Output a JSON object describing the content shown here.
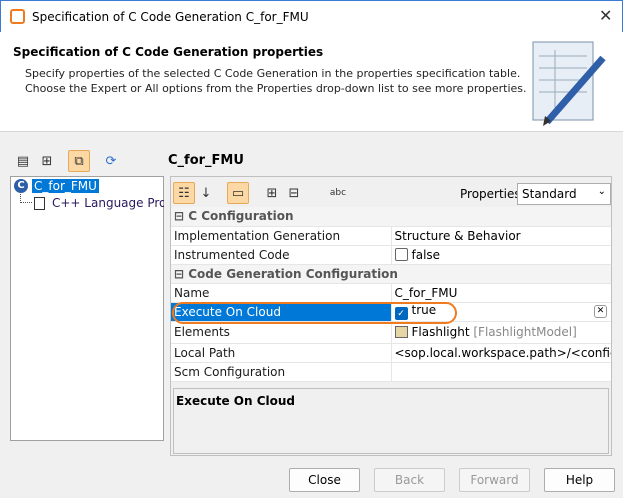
{
  "window": {
    "title": "Specification of C Code Generation C_for_FMU"
  },
  "header": {
    "title": "Specification of C Code Generation properties",
    "desc1": "Specify properties of the selected C Code Generation in the properties specification table.",
    "desc2": "Choose the Expert or All options from the Properties drop-down list to see more properties."
  },
  "element_title": "C_for_FMU",
  "tree": {
    "root": "C_for_FMU",
    "child": "C++ Language Properties"
  },
  "properties": {
    "label": "Properties:",
    "selected": "Standard"
  },
  "table": {
    "group1": "C Configuration",
    "impl_label": "Implementation Generation",
    "impl_value": "Structure & Behavior",
    "instr_label": "Instrumented Code",
    "instr_value": "false",
    "group2": "Code Generation Configuration",
    "name_label": "Name",
    "name_value": "C_for_FMU",
    "cloud_label": "Execute On Cloud",
    "cloud_value": "true",
    "elements_label": "Elements",
    "elements_value": "Flashlight",
    "elements_type": "[FlashlightModel]",
    "path_label": "Local Path",
    "path_value": "<sop.local.workspace.path>/<configuration",
    "scm_label": "Scm Configuration",
    "scm_value": ""
  },
  "description": {
    "title": "Execute On Cloud"
  },
  "buttons": {
    "close": "Close",
    "back": "Back",
    "forward": "Forward",
    "help": "Help"
  },
  "colors": {
    "selection": "#0078d7",
    "highlight": "#f07b1f"
  }
}
